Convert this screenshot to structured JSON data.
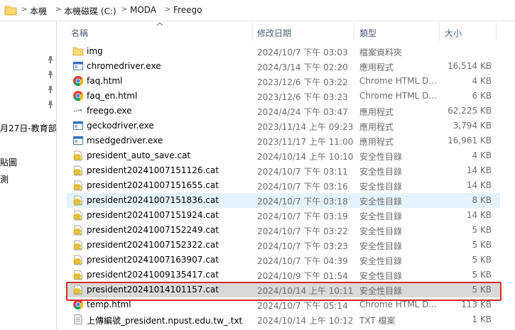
{
  "breadcrumb": [
    "本機",
    "本機磁碟 (C:)",
    "MODA",
    "Freego"
  ],
  "nav_texts": [
    "月27日-教育部-",
    "貼圖",
    "測"
  ],
  "columns": {
    "name": "名稱",
    "date": "修改日期",
    "type": "類型",
    "size": "大小"
  },
  "files": [
    {
      "icon": "folder-icon",
      "name": "img",
      "date": "2024/10/7 下午 03:03",
      "type": "檔案資料夾",
      "size": ""
    },
    {
      "icon": "exe-icon",
      "name": "chromedriver.exe",
      "date": "2024/3/14 下午 02:20",
      "type": "應用程式",
      "size": "16,514 KB"
    },
    {
      "icon": "chrome-icon",
      "name": "faq.html",
      "date": "2023/12/6 下午 03:22",
      "type": "Chrome HTML D...",
      "size": "4 KB"
    },
    {
      "icon": "chrome-icon",
      "name": "faq_en.html",
      "date": "2023/12/6 下午 03:23",
      "type": "Chrome HTML D...",
      "size": "6 KB"
    },
    {
      "icon": "freego-icon",
      "name": "freego.exe",
      "date": "2024/4/24 下午 03:47",
      "type": "應用程式",
      "size": "62,225 KB"
    },
    {
      "icon": "exe-icon",
      "name": "geckodriver.exe",
      "date": "2023/11/14 上午 09:23",
      "type": "應用程式",
      "size": "3,794 KB"
    },
    {
      "icon": "exe-icon",
      "name": "msedgedriver.exe",
      "date": "2023/11/17 上午 11:00",
      "type": "應用程式",
      "size": "16,961 KB"
    },
    {
      "icon": "catalog-icon",
      "name": "president_auto_save.cat",
      "date": "2024/10/14 上午 10:10",
      "type": "安全性目錄",
      "size": "4 KB"
    },
    {
      "icon": "catalog-icon",
      "name": "president20241007151126.cat",
      "date": "2024/10/7 下午 03:11",
      "type": "安全性目錄",
      "size": "14 KB"
    },
    {
      "icon": "catalog-icon",
      "name": "president20241007151655.cat",
      "date": "2024/10/7 下午 03:16",
      "type": "安全性目錄",
      "size": "14 KB"
    },
    {
      "icon": "catalog-icon",
      "name": "president20241007151836.cat",
      "date": "2024/10/7 下午 03:18",
      "type": "安全性目錄",
      "size": "8 KB",
      "state": "hover"
    },
    {
      "icon": "catalog-icon",
      "name": "president20241007151924.cat",
      "date": "2024/10/7 下午 03:19",
      "type": "安全性目錄",
      "size": "14 KB"
    },
    {
      "icon": "catalog-icon",
      "name": "president20241007152249.cat",
      "date": "2024/10/7 下午 03:22",
      "type": "安全性目錄",
      "size": "5 KB"
    },
    {
      "icon": "catalog-icon",
      "name": "president20241007152322.cat",
      "date": "2024/10/7 下午 03:23",
      "type": "安全性目錄",
      "size": "5 KB"
    },
    {
      "icon": "catalog-icon",
      "name": "president20241007163907.cat",
      "date": "2024/10/7 下午 04:39",
      "type": "安全性目錄",
      "size": "5 KB"
    },
    {
      "icon": "catalog-icon",
      "name": "president20241009135417.cat",
      "date": "2024/10/9 下午 01:54",
      "type": "安全性目錄",
      "size": "5 KB"
    },
    {
      "icon": "catalog-icon",
      "name": "president20241014101157.cat",
      "date": "2024/10/14 上午 10:11",
      "type": "安全性目錄",
      "size": "5 KB",
      "state": "selected"
    },
    {
      "icon": "chrome-icon",
      "name": "temp.html",
      "date": "2024/10/7 下午 05:14",
      "type": "Chrome HTML D...",
      "size": "113 KB"
    },
    {
      "icon": "txt-icon",
      "name": "上傳編號_president.npust.edu.tw_.txt",
      "date": "2024/10/14 上午 10:12",
      "type": "TXT 檔案",
      "size": "1 KB"
    }
  ],
  "colors": {
    "highlight_border": "#d62b2b",
    "hover_bg": "#e5f3ff",
    "selected_bg": "#d9d9d9",
    "header_text": "#4c607a"
  }
}
